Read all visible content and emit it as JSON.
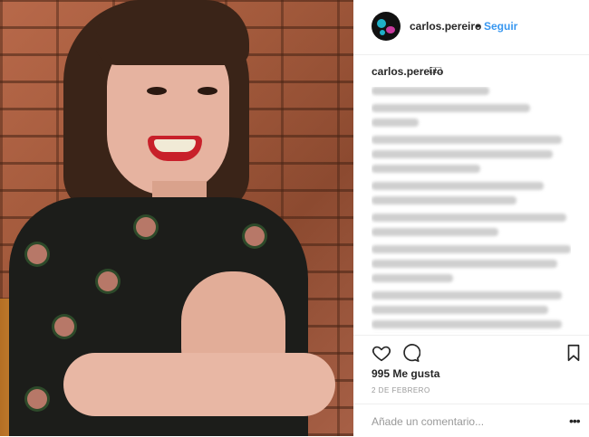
{
  "post": {
    "username": "carlos.pereiro",
    "separator": "•",
    "follow_label": "Seguir",
    "caption_emoji": "□□",
    "likes": "995 Me gusta",
    "date": "2 de febrero",
    "comment_placeholder": "Añade un comentario...",
    "more_label": "•••"
  },
  "icons": {
    "heart": "heart-icon",
    "comment": "comment-icon",
    "bookmark": "bookmark-icon",
    "avatar": "avatar"
  },
  "colors": {
    "accent": "#3897f0",
    "text": "#262626",
    "muted": "#999999",
    "divider": "#efefef"
  }
}
